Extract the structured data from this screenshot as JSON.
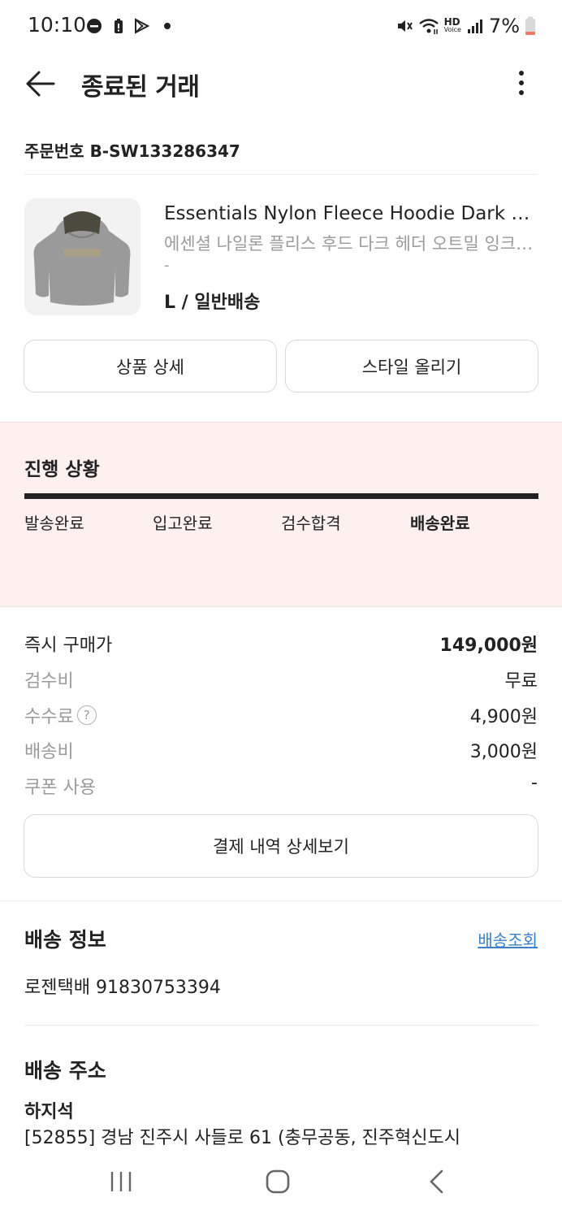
{
  "status_bar": {
    "time": "10:10",
    "battery": "7%",
    "hd_label": "HD",
    "voice_label": "Voice"
  },
  "header": {
    "title": "종료된 거래"
  },
  "order": {
    "number_label": "주문번호 B-SW133286347"
  },
  "product": {
    "name_en": "Essentials Nylon Fleece Hoodie Dark Heather Oatmeal",
    "name_ko": "에센셜 나일론 플리스 후드 다크 헤더 오트밀 잉크 그린",
    "dash": "-",
    "option": "L / 일반배송"
  },
  "buttons": {
    "detail": "상품 상세",
    "style": "스타일 올리기",
    "payment_detail": "결제 내역 상세보기"
  },
  "progress": {
    "title": "진행 상황",
    "steps": [
      "발송완료",
      "입고완료",
      "검수합격",
      "배송완료"
    ],
    "active_index": 3,
    "completion": 1.0
  },
  "price": {
    "rows": [
      {
        "label": "즉시 구매가",
        "value": "149,000원"
      },
      {
        "label": "검수비",
        "value": "무료"
      },
      {
        "label": "수수료",
        "value": "4,900원",
        "help_icon": "?"
      },
      {
        "label": "배송비",
        "value": "3,000원"
      },
      {
        "label": "쿠폰 사용",
        "value": "-"
      }
    ]
  },
  "delivery": {
    "title": "배송 정보",
    "track_link": "배송조회",
    "carrier": "로젠택배 91830753394"
  },
  "address": {
    "title": "배송 주소",
    "name": "하지석",
    "line": "[52855] 경남 진주시 사들로 61 (충무공동, 진주혁신도시"
  },
  "colors": {
    "progress_bg": "#fdf1ef",
    "link": "#3a82c5",
    "bar": "#222222"
  }
}
